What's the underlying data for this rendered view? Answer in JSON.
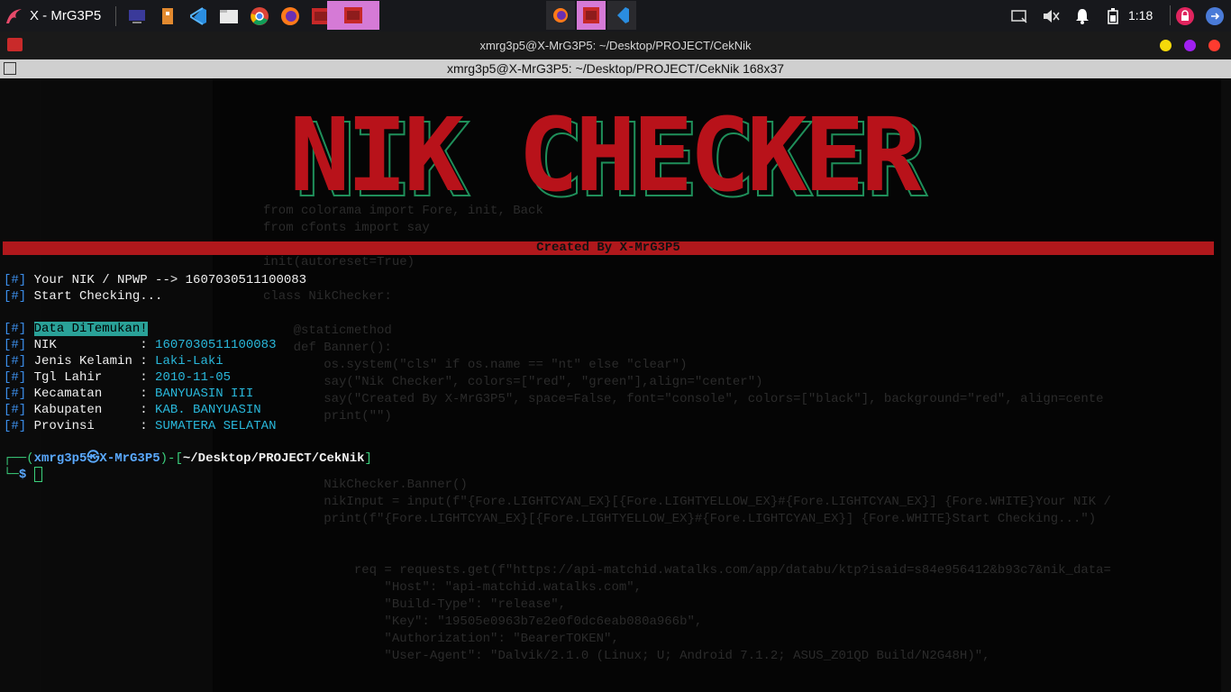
{
  "panel": {
    "window_name": "X - MrG3P5",
    "clock": "1:18"
  },
  "titlebar": {
    "title": "xmrg3p5@X-MrG3P5: ~/Desktop/PROJECT/CekNik"
  },
  "tabbar": {
    "title": "xmrg3p5@X-MrG3P5: ~/Desktop/PROJECT/CekNik 168x37"
  },
  "banner": {
    "text": "NIK CHECKER",
    "subtitle": "Created By X-MrG3P5"
  },
  "output": {
    "mark": "[#]",
    "input_label": "Your NIK / NPWP --> ",
    "input_value": "1607030511100083",
    "checking": "Start Checking...",
    "found": "Data DiTemukan!",
    "fields": [
      {
        "label": "NIK           : ",
        "value": "1607030511100083"
      },
      {
        "label": "Jenis Kelamin : ",
        "value": "Laki-Laki"
      },
      {
        "label": "Tgl Lahir     : ",
        "value": "2010-11-05"
      },
      {
        "label": "Kecamatan     : ",
        "value": "BANYUASIN III"
      },
      {
        "label": "Kabupaten     : ",
        "value": "KAB. BANYUASIN"
      },
      {
        "label": "Provinsi      : ",
        "value": "SUMATERA SELATAN"
      }
    ]
  },
  "prompt": {
    "open": "┌──(",
    "user": "xmrg3p5㉿X-MrG3P5",
    "mid": ")-[",
    "path": "~/Desktop/PROJECT/CekNik",
    "close": "]",
    "corner": "└─",
    "dollar": "$"
  },
  "background_code": [
    "from colorama import Fore, init, Back",
    "from cfonts import say",
    "init(autoreset=True)",
    "class NikChecker:",
    "    @staticmethod",
    "    def Banner():",
    "        os.system(\"cls\" if os.name == \"nt\" else \"clear\")",
    "        say(\"Nik Checker\", colors=[\"red\", \"green\"],align=\"center\")",
    "        say(\"Created By X-MrG3P5\", space=False, font=\"console\", colors=[\"black\"], background=\"red\", align=cente",
    "        print(\"\")",
    "        NikChecker.Banner()",
    "        nikInput = input(f\"{Fore.LIGHTCYAN_EX}[{Fore.LIGHTYELLOW_EX}#{Fore.LIGHTCYAN_EX}] {Fore.WHITE}Your NIK /",
    "        print(f\"{Fore.LIGHTCYAN_EX}[{Fore.LIGHTYELLOW_EX}#{Fore.LIGHTCYAN_EX}] {Fore.WHITE}Start Checking...\")",
    "            req = requests.get(f\"https://api-matchid.watalks.com/app/databu/ktp?isaid=s84e956412&b93c7&nik_data=",
    "                \"Host\": \"api-matchid.watalks.com\",",
    "                \"Build-Type\": \"release\",",
    "                \"Key\": \"19505e0963b7e2e0f0dc6eab080a966b\",",
    "                \"Authorization\": \"BearerTOKEN\",",
    "                \"User-Agent\": \"Dalvik/2.1.0 (Linux; U; Android 7.1.2; ASUS_Z01QD Build/N2G48H)\","
  ]
}
